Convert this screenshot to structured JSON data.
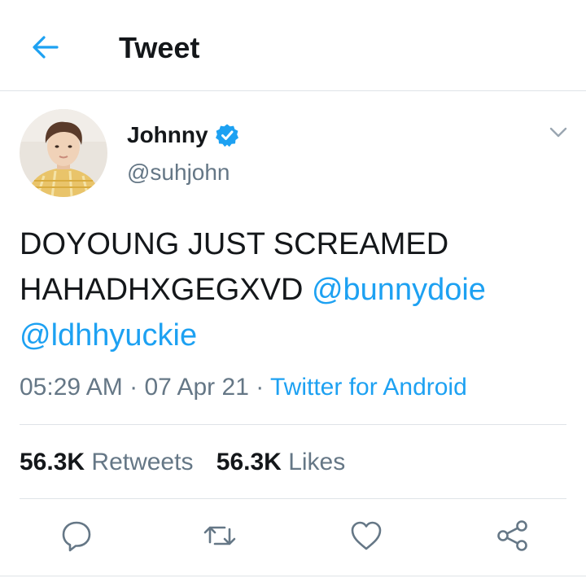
{
  "header": {
    "title": "Tweet",
    "back_icon": "back-arrow-icon",
    "accent": "#1da1f2"
  },
  "author": {
    "name": "Johnny",
    "handle": "@suhjohn",
    "verified": true,
    "avatar": "profile-photo"
  },
  "tweet": {
    "text_line1": "DOYOUNG JUST SCREAMED",
    "text_line2_plain": "HAHADHXGEGXVD ",
    "mention_1": "@bunnydoie",
    "mention_2": "@ldhhyuckie"
  },
  "meta": {
    "time": "05:29 AM",
    "separator": " · ",
    "date": "07 Apr 21",
    "source": "Twitter for Android"
  },
  "stats": {
    "retweets_count": "56.3K",
    "retweets_label": " Retweets",
    "likes_count": "56.3K",
    "likes_label": " Likes"
  },
  "actions": [
    "reply-icon",
    "retweet-icon",
    "like-icon",
    "share-icon"
  ],
  "colors": {
    "text": "#14171a",
    "secondary": "#657786",
    "link": "#1da1f2",
    "divider": "#dfe3e7"
  }
}
